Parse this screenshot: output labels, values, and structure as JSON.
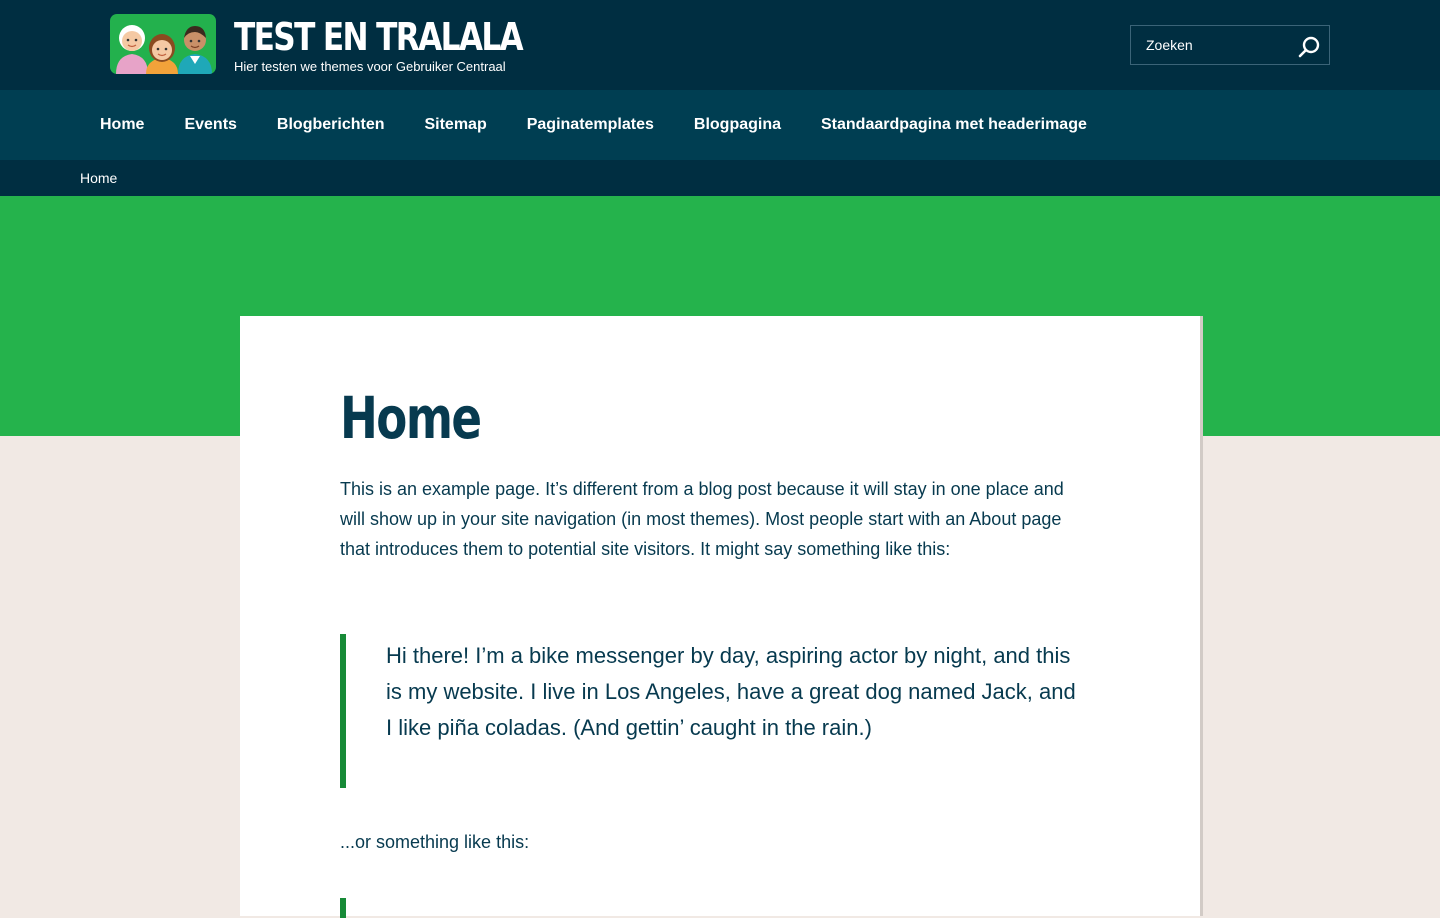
{
  "header": {
    "site_title": "TEST EN TRALALA",
    "tagline": "Hier testen we themes voor Gebruiker Centraal",
    "search": {
      "placeholder": "Zoeken",
      "icon": "search-icon"
    },
    "logo_icon": "people-logo-icon"
  },
  "nav": {
    "items": [
      {
        "label": "Home"
      },
      {
        "label": "Events"
      },
      {
        "label": "Blogberichten"
      },
      {
        "label": "Sitemap"
      },
      {
        "label": "Paginatemplates"
      },
      {
        "label": "Blogpagina"
      },
      {
        "label": "Standaardpagina met headerimage"
      }
    ]
  },
  "breadcrumb": {
    "current": "Home"
  },
  "main": {
    "title": "Home",
    "intro": "This is an example page. It’s different from a blog post because it will stay in one place and will show up in your site navigation (in most themes). Most people start with an About page that introduces them to potential site visitors. It might say something like this:",
    "quote": "Hi there! I’m a bike messenger by day, aspiring actor by night, and this is my website. I live in Los Angeles, have a great dog named Jack, and I like piña coladas. (And gettin’ caught in the rain.)",
    "outro": "...or something like this:"
  },
  "colors": {
    "header_bg": "#002e41",
    "nav_bg": "#003e52",
    "hero_green": "#25b34c",
    "quote_border": "#178a37",
    "page_bg": "#f1e9e4",
    "text": "#073a4f"
  }
}
